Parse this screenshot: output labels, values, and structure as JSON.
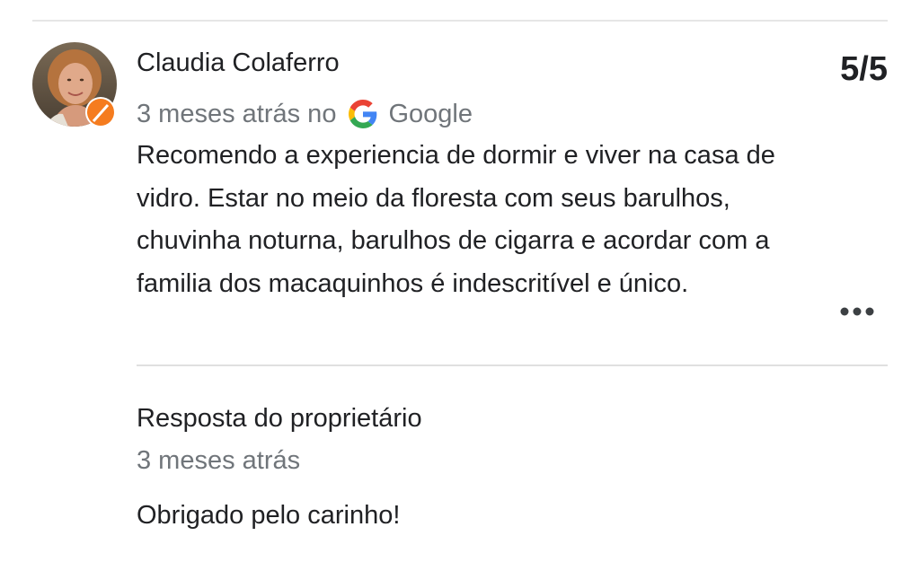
{
  "review": {
    "author_name": "Claudia Colaferro",
    "rating": "5/5",
    "time_ago": "3 meses atrás no",
    "source": "Google",
    "source_icon": "google-g-icon",
    "text": "Recomendo a experiencia de dormir e viver na casa de vidro. Estar no meio da floresta com seus barulhos, chuvinha noturna, barulhos de cigarra e acordar com a familia dos macaquinhos é indescritível e único.",
    "more_icon": "more-horiz-icon"
  },
  "owner_response": {
    "label": "Resposta do proprietário",
    "time_ago": "3 meses atrás",
    "text": "Obrigado pelo carinho!"
  },
  "colors": {
    "text_primary": "#202124",
    "text_secondary": "#70757a",
    "divider": "#e0e0e0",
    "avatar_badge": "#f57c1f"
  }
}
